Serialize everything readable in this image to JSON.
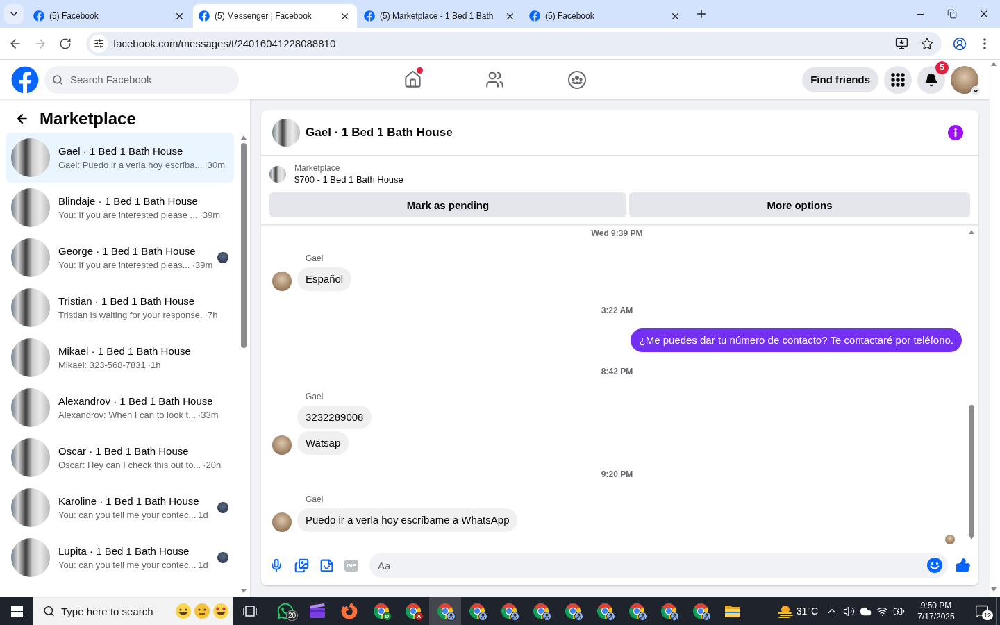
{
  "browser": {
    "tabs": [
      {
        "title": "(5) Facebook",
        "selected": false
      },
      {
        "title": "(5) Messenger | Facebook",
        "selected": true
      },
      {
        "title": "(5) Marketplace - 1 Bed 1 Bath",
        "selected": false
      },
      {
        "title": "(5) Facebook",
        "selected": false
      }
    ],
    "url": "facebook.com/messages/t/24016041228088810"
  },
  "header": {
    "search_placeholder": "Search Facebook",
    "nav": [
      {
        "kind": "home",
        "dot": true
      },
      {
        "kind": "friends",
        "dot": false
      },
      {
        "kind": "groups",
        "dot": false
      }
    ],
    "find_friends": "Find friends",
    "notification_count": "5"
  },
  "sidebar": {
    "title": "Marketplace",
    "conversations": [
      {
        "title": "Gael · 1 Bed 1 Bath House",
        "preview": "Gael: Puedo ir a verla hoy escríba...",
        "time": "·30m",
        "selected": true,
        "seen": false
      },
      {
        "title": "Blindaje · 1 Bed 1 Bath House",
        "preview": "You: If you are interested please ...",
        "time": "·39m",
        "selected": false,
        "seen": false
      },
      {
        "title": "George · 1 Bed 1 Bath House",
        "preview": "You: If you are interested pleas...",
        "time": "·39m",
        "selected": false,
        "seen": true
      },
      {
        "title": "Tristian · 1 Bed 1 Bath House",
        "preview": "Tristian is waiting for your response.",
        "time": "·7h",
        "selected": false,
        "seen": false
      },
      {
        "title": "Mikael · 1 Bed 1 Bath House",
        "preview": "Mikael: 323-568-7831",
        "time": "·1h",
        "selected": false,
        "seen": false
      },
      {
        "title": "Alexandrov · 1 Bed 1 Bath House",
        "preview": "Alexandrov: When I can to look t...",
        "time": "·33m",
        "selected": false,
        "seen": false
      },
      {
        "title": "Oscar · 1 Bed 1 Bath House",
        "preview": "Oscar: Hey can I check this out to...",
        "time": "·20h",
        "selected": false,
        "seen": false
      },
      {
        "title": "Karoline · 1 Bed 1 Bath House",
        "preview": "You: can you tell me your contec...",
        "time": "1d",
        "selected": false,
        "seen": true
      },
      {
        "title": "Lupita · 1 Bed 1 Bath House",
        "preview": "You: can you tell me your contec...",
        "time": "1d",
        "selected": false,
        "seen": true
      }
    ]
  },
  "chat": {
    "title": "Gael · 1 Bed 1 Bath House",
    "listing": {
      "source": "Marketplace",
      "title": "$700 - 1 Bed 1 Bath House",
      "actions": [
        "Mark as pending",
        "More options"
      ]
    },
    "messages": [
      {
        "kind": "time",
        "text": "Wed 9:39 PM"
      },
      {
        "kind": "incoming",
        "sender": "Gael",
        "bubbles": [
          "Español"
        ]
      },
      {
        "kind": "time",
        "text": "3:22 AM"
      },
      {
        "kind": "outgoing",
        "bubbles": [
          "¿Me puedes dar tu número de contacto? Te contactaré por teléfono."
        ]
      },
      {
        "kind": "time",
        "text": "8:42 PM"
      },
      {
        "kind": "incoming",
        "sender": "Gael",
        "bubbles": [
          "3232289008",
          "Watsap"
        ]
      },
      {
        "kind": "time",
        "text": "9:20 PM"
      },
      {
        "kind": "incoming",
        "sender": "Gael",
        "bubbles": [
          "Puedo ir a verla hoy escríbame a WhatsApp"
        ]
      }
    ],
    "composer": {
      "gif_label": "GIF",
      "placeholder": "Aa"
    }
  },
  "taskbar": {
    "search_placeholder": "Type here to search",
    "apps": [
      {
        "kind": "whatsapp",
        "badge": "20",
        "active": false
      },
      {
        "kind": "video",
        "active": false
      },
      {
        "kind": "firefox",
        "active": false
      },
      {
        "kind": "chrome",
        "profile": "D",
        "color": "#1e8e3e",
        "active": false
      },
      {
        "kind": "chrome",
        "profile": "A",
        "color": "#c5221f",
        "active": false
      },
      {
        "kind": "chrome",
        "active": true
      },
      {
        "kind": "chrome",
        "active": false
      },
      {
        "kind": "chrome",
        "active": false
      },
      {
        "kind": "chrome",
        "active": false
      },
      {
        "kind": "chrome",
        "active": false
      },
      {
        "kind": "chrome",
        "active": false
      },
      {
        "kind": "chrome",
        "active": false
      },
      {
        "kind": "chrome",
        "active": false
      },
      {
        "kind": "chrome",
        "active": false
      },
      {
        "kind": "explorer",
        "active": false
      }
    ],
    "weather": "31°C",
    "time": "9:50 PM",
    "date": "7/17/2025",
    "notification_count": "12"
  }
}
